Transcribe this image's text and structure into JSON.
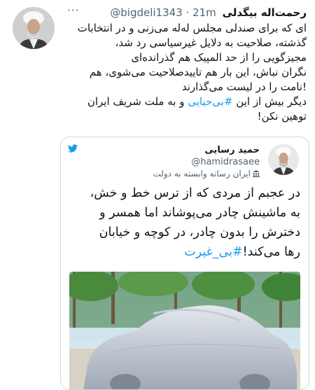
{
  "tweet": {
    "author_name": "رحمت‌اله بیگدلی",
    "handle": "@bigdeli1343",
    "time": "· 21m",
    "more_label": "···",
    "body_lines": [
      "ای که برای صندلی مجلس له‌له می‌زنی و در انتخابات",
      "گذشته، صلاحیت به دلایل غیرسیاسی رد شد،",
      "مجیزگویی را از حد المپیک هم گذرانده‌ای",
      "نگران نباش، این بار هم تاییدصلاحیت می‌شوی، هم",
      "!نامت را در لیست می‌گذارند"
    ],
    "body_line6_before": "دیگر بیش از این ",
    "body_hashtag": "#بی‌حیایی",
    "body_line6_after": " و به ملت شریف ایران",
    "body_line7": "توهین نکن!"
  },
  "quote": {
    "author_name": "حمید رسایی",
    "handle": "@hamidrasaee",
    "label": "ایران رسانه وابسته به دولت",
    "text_lines": [
      "در عجبم از مردی که از ترس خط و خش،",
      "به ماشینش چادر می‌پوشاند اما همسر و",
      "دخترش را بدون چادر، در کوچه و خیابان"
    ],
    "text_last_before": "رها می‌کند!",
    "text_hashtag": "#بی_غیرت"
  },
  "icons": {
    "more": "more-dots-icon",
    "logo": "twitter-bird-icon",
    "gov": "government-building-icon"
  },
  "colors": {
    "accent": "#1d9bf0",
    "secondary_text": "#536471"
  }
}
